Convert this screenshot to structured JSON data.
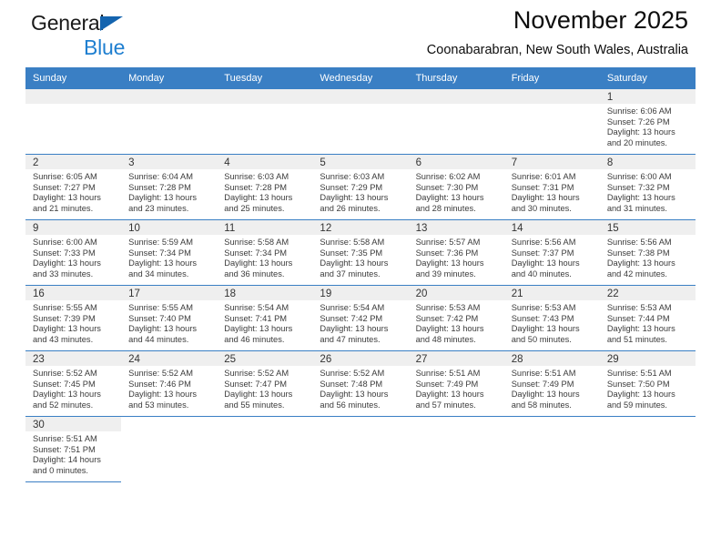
{
  "brand": {
    "line1": "General",
    "line2": "Blue",
    "flag_icon": "triangle-flag-icon",
    "colors": {
      "blue": "#1f7fd0",
      "flag": "#1464af",
      "dark": "#1a1a1a"
    }
  },
  "header": {
    "title": "November 2025",
    "subtitle": "Coonabarabran, New South Wales, Australia"
  },
  "calendar": {
    "accent_color": "#3a7fc4",
    "daynum_bg": "#efefef",
    "weekdays": [
      "Sunday",
      "Monday",
      "Tuesday",
      "Wednesday",
      "Thursday",
      "Friday",
      "Saturday"
    ],
    "weeks": [
      [
        {
          "day": "",
          "empty": true,
          "sunrise": "",
          "sunset": "",
          "daylight1": "",
          "daylight2": ""
        },
        {
          "day": "",
          "empty": true,
          "sunrise": "",
          "sunset": "",
          "daylight1": "",
          "daylight2": ""
        },
        {
          "day": "",
          "empty": true,
          "sunrise": "",
          "sunset": "",
          "daylight1": "",
          "daylight2": ""
        },
        {
          "day": "",
          "empty": true,
          "sunrise": "",
          "sunset": "",
          "daylight1": "",
          "daylight2": ""
        },
        {
          "day": "",
          "empty": true,
          "sunrise": "",
          "sunset": "",
          "daylight1": "",
          "daylight2": ""
        },
        {
          "day": "",
          "empty": true,
          "sunrise": "",
          "sunset": "",
          "daylight1": "",
          "daylight2": ""
        },
        {
          "day": "1",
          "sunrise": "Sunrise: 6:06 AM",
          "sunset": "Sunset: 7:26 PM",
          "daylight1": "Daylight: 13 hours",
          "daylight2": "and 20 minutes."
        }
      ],
      [
        {
          "day": "2",
          "sunrise": "Sunrise: 6:05 AM",
          "sunset": "Sunset: 7:27 PM",
          "daylight1": "Daylight: 13 hours",
          "daylight2": "and 21 minutes."
        },
        {
          "day": "3",
          "sunrise": "Sunrise: 6:04 AM",
          "sunset": "Sunset: 7:28 PM",
          "daylight1": "Daylight: 13 hours",
          "daylight2": "and 23 minutes."
        },
        {
          "day": "4",
          "sunrise": "Sunrise: 6:03 AM",
          "sunset": "Sunset: 7:28 PM",
          "daylight1": "Daylight: 13 hours",
          "daylight2": "and 25 minutes."
        },
        {
          "day": "5",
          "sunrise": "Sunrise: 6:03 AM",
          "sunset": "Sunset: 7:29 PM",
          "daylight1": "Daylight: 13 hours",
          "daylight2": "and 26 minutes."
        },
        {
          "day": "6",
          "sunrise": "Sunrise: 6:02 AM",
          "sunset": "Sunset: 7:30 PM",
          "daylight1": "Daylight: 13 hours",
          "daylight2": "and 28 minutes."
        },
        {
          "day": "7",
          "sunrise": "Sunrise: 6:01 AM",
          "sunset": "Sunset: 7:31 PM",
          "daylight1": "Daylight: 13 hours",
          "daylight2": "and 30 minutes."
        },
        {
          "day": "8",
          "sunrise": "Sunrise: 6:00 AM",
          "sunset": "Sunset: 7:32 PM",
          "daylight1": "Daylight: 13 hours",
          "daylight2": "and 31 minutes."
        }
      ],
      [
        {
          "day": "9",
          "sunrise": "Sunrise: 6:00 AM",
          "sunset": "Sunset: 7:33 PM",
          "daylight1": "Daylight: 13 hours",
          "daylight2": "and 33 minutes."
        },
        {
          "day": "10",
          "sunrise": "Sunrise: 5:59 AM",
          "sunset": "Sunset: 7:34 PM",
          "daylight1": "Daylight: 13 hours",
          "daylight2": "and 34 minutes."
        },
        {
          "day": "11",
          "sunrise": "Sunrise: 5:58 AM",
          "sunset": "Sunset: 7:34 PM",
          "daylight1": "Daylight: 13 hours",
          "daylight2": "and 36 minutes."
        },
        {
          "day": "12",
          "sunrise": "Sunrise: 5:58 AM",
          "sunset": "Sunset: 7:35 PM",
          "daylight1": "Daylight: 13 hours",
          "daylight2": "and 37 minutes."
        },
        {
          "day": "13",
          "sunrise": "Sunrise: 5:57 AM",
          "sunset": "Sunset: 7:36 PM",
          "daylight1": "Daylight: 13 hours",
          "daylight2": "and 39 minutes."
        },
        {
          "day": "14",
          "sunrise": "Sunrise: 5:56 AM",
          "sunset": "Sunset: 7:37 PM",
          "daylight1": "Daylight: 13 hours",
          "daylight2": "and 40 minutes."
        },
        {
          "day": "15",
          "sunrise": "Sunrise: 5:56 AM",
          "sunset": "Sunset: 7:38 PM",
          "daylight1": "Daylight: 13 hours",
          "daylight2": "and 42 minutes."
        }
      ],
      [
        {
          "day": "16",
          "sunrise": "Sunrise: 5:55 AM",
          "sunset": "Sunset: 7:39 PM",
          "daylight1": "Daylight: 13 hours",
          "daylight2": "and 43 minutes."
        },
        {
          "day": "17",
          "sunrise": "Sunrise: 5:55 AM",
          "sunset": "Sunset: 7:40 PM",
          "daylight1": "Daylight: 13 hours",
          "daylight2": "and 44 minutes."
        },
        {
          "day": "18",
          "sunrise": "Sunrise: 5:54 AM",
          "sunset": "Sunset: 7:41 PM",
          "daylight1": "Daylight: 13 hours",
          "daylight2": "and 46 minutes."
        },
        {
          "day": "19",
          "sunrise": "Sunrise: 5:54 AM",
          "sunset": "Sunset: 7:42 PM",
          "daylight1": "Daylight: 13 hours",
          "daylight2": "and 47 minutes."
        },
        {
          "day": "20",
          "sunrise": "Sunrise: 5:53 AM",
          "sunset": "Sunset: 7:42 PM",
          "daylight1": "Daylight: 13 hours",
          "daylight2": "and 48 minutes."
        },
        {
          "day": "21",
          "sunrise": "Sunrise: 5:53 AM",
          "sunset": "Sunset: 7:43 PM",
          "daylight1": "Daylight: 13 hours",
          "daylight2": "and 50 minutes."
        },
        {
          "day": "22",
          "sunrise": "Sunrise: 5:53 AM",
          "sunset": "Sunset: 7:44 PM",
          "daylight1": "Daylight: 13 hours",
          "daylight2": "and 51 minutes."
        }
      ],
      [
        {
          "day": "23",
          "sunrise": "Sunrise: 5:52 AM",
          "sunset": "Sunset: 7:45 PM",
          "daylight1": "Daylight: 13 hours",
          "daylight2": "and 52 minutes."
        },
        {
          "day": "24",
          "sunrise": "Sunrise: 5:52 AM",
          "sunset": "Sunset: 7:46 PM",
          "daylight1": "Daylight: 13 hours",
          "daylight2": "and 53 minutes."
        },
        {
          "day": "25",
          "sunrise": "Sunrise: 5:52 AM",
          "sunset": "Sunset: 7:47 PM",
          "daylight1": "Daylight: 13 hours",
          "daylight2": "and 55 minutes."
        },
        {
          "day": "26",
          "sunrise": "Sunrise: 5:52 AM",
          "sunset": "Sunset: 7:48 PM",
          "daylight1": "Daylight: 13 hours",
          "daylight2": "and 56 minutes."
        },
        {
          "day": "27",
          "sunrise": "Sunrise: 5:51 AM",
          "sunset": "Sunset: 7:49 PM",
          "daylight1": "Daylight: 13 hours",
          "daylight2": "and 57 minutes."
        },
        {
          "day": "28",
          "sunrise": "Sunrise: 5:51 AM",
          "sunset": "Sunset: 7:49 PM",
          "daylight1": "Daylight: 13 hours",
          "daylight2": "and 58 minutes."
        },
        {
          "day": "29",
          "sunrise": "Sunrise: 5:51 AM",
          "sunset": "Sunset: 7:50 PM",
          "daylight1": "Daylight: 13 hours",
          "daylight2": "and 59 minutes."
        }
      ],
      [
        {
          "day": "30",
          "sunrise": "Sunrise: 5:51 AM",
          "sunset": "Sunset: 7:51 PM",
          "daylight1": "Daylight: 14 hours",
          "daylight2": "and 0 minutes."
        },
        {
          "day": "",
          "nofill": true,
          "sunrise": "",
          "sunset": "",
          "daylight1": "",
          "daylight2": ""
        },
        {
          "day": "",
          "nofill": true,
          "sunrise": "",
          "sunset": "",
          "daylight1": "",
          "daylight2": ""
        },
        {
          "day": "",
          "nofill": true,
          "sunrise": "",
          "sunset": "",
          "daylight1": "",
          "daylight2": ""
        },
        {
          "day": "",
          "nofill": true,
          "sunrise": "",
          "sunset": "",
          "daylight1": "",
          "daylight2": ""
        },
        {
          "day": "",
          "nofill": true,
          "sunrise": "",
          "sunset": "",
          "daylight1": "",
          "daylight2": ""
        },
        {
          "day": "",
          "nofill": true,
          "sunrise": "",
          "sunset": "",
          "daylight1": "",
          "daylight2": ""
        }
      ]
    ]
  }
}
